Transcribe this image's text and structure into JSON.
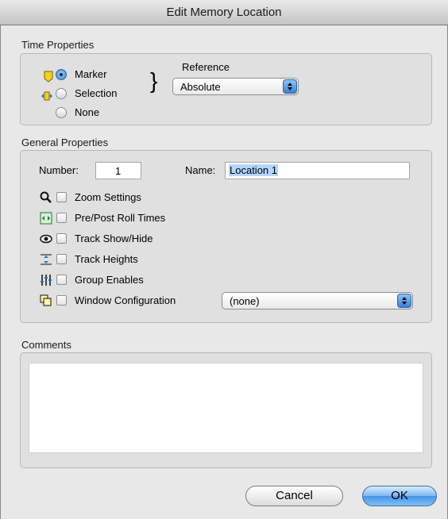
{
  "window": {
    "title": "Edit Memory Location"
  },
  "time_properties": {
    "section_label": "Time Properties",
    "options": [
      {
        "label": "Marker",
        "selected": true,
        "icon": "marker-icon"
      },
      {
        "label": "Selection",
        "selected": false,
        "icon": "selection-icon"
      },
      {
        "label": "None",
        "selected": false,
        "icon": ""
      }
    ],
    "reference_label": "Reference",
    "reference_value": "Absolute",
    "brace": "}"
  },
  "general_properties": {
    "section_label": "General Properties",
    "number_label": "Number:",
    "number_value": "1",
    "name_label": "Name:",
    "name_value": "Location 1",
    "checkboxes": [
      {
        "label": "Zoom Settings",
        "icon": "magnifier-icon",
        "checked": false
      },
      {
        "label": "Pre/Post Roll Times",
        "icon": "pre-post-roll-icon",
        "checked": false
      },
      {
        "label": "Track Show/Hide",
        "icon": "eye-icon",
        "checked": false
      },
      {
        "label": "Track Heights",
        "icon": "track-heights-icon",
        "checked": false
      },
      {
        "label": "Group Enables",
        "icon": "group-enables-icon",
        "checked": false
      },
      {
        "label": "Window Configuration",
        "icon": "window-config-icon",
        "checked": false
      }
    ],
    "window_config_value": "(none)"
  },
  "comments": {
    "section_label": "Comments",
    "value": ""
  },
  "buttons": {
    "cancel": "Cancel",
    "ok": "OK"
  },
  "colors": {
    "accent": "#4a93e2",
    "marker_yellow": "#f2d21a",
    "window_bg": "#e8e8e8"
  }
}
